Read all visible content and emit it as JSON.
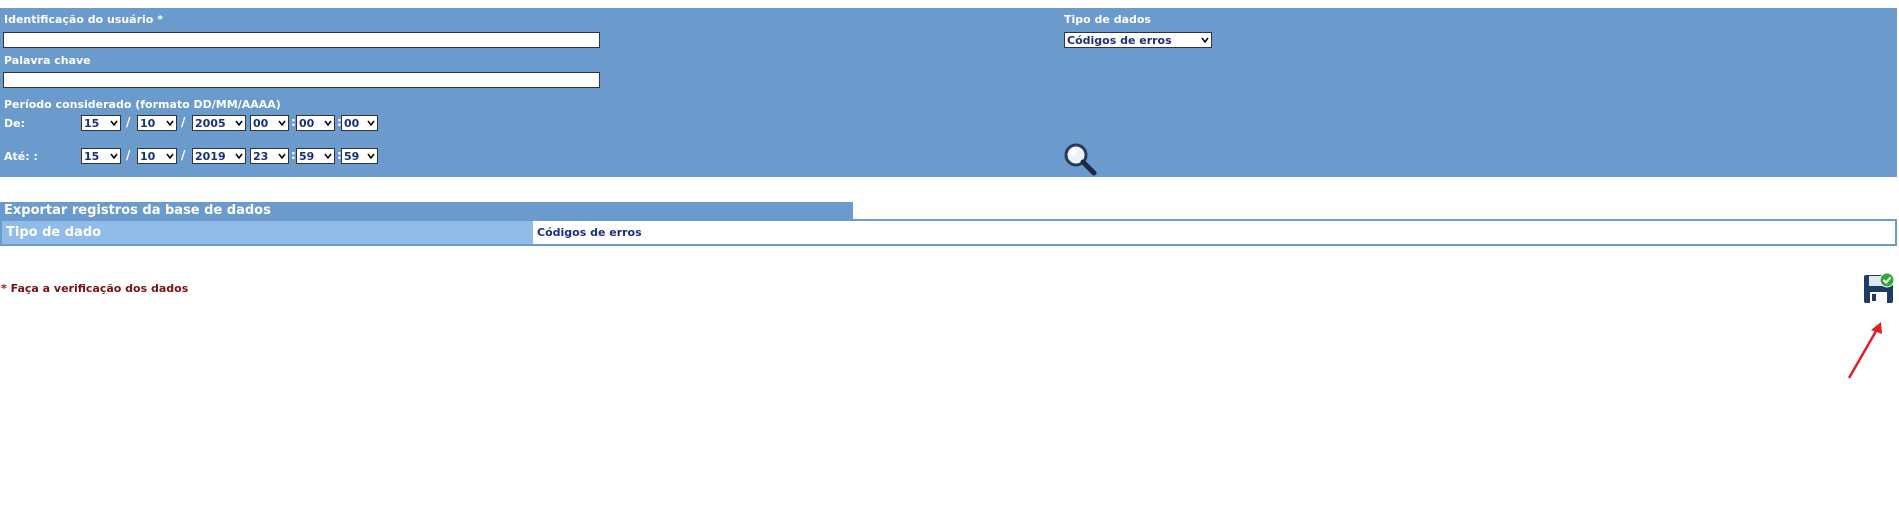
{
  "filters": {
    "user_id_label": "Identificação do usuário *",
    "user_id_value": "",
    "keyword_label": "Palavra chave",
    "keyword_value": "",
    "data_type_label": "Tipo de dados",
    "data_type_selected": "Códigos de erros",
    "period_label": "Período considerado (formato DD/MM/AAAA)",
    "from_label": "De:",
    "to_label": "Até: :",
    "from": {
      "day": "15",
      "month": "10",
      "year": "2005",
      "hour": "00",
      "minute": "00",
      "second": "00"
    },
    "to": {
      "day": "15",
      "month": "10",
      "year": "2019",
      "hour": "23",
      "minute": "59",
      "second": "59"
    },
    "date_sep": "/",
    "time_sep": ":"
  },
  "export": {
    "title": "Exportar registros da base de dados",
    "row_key": "Tipo de dado",
    "row_value": "Códigos de erros"
  },
  "note": {
    "star": "*",
    "text": "Faça a verificação dos dados"
  },
  "icons": {
    "search": "search-icon",
    "save": "save-verify-icon",
    "annotation": "red-arrow"
  },
  "colors": {
    "panel": "#6b9bcc",
    "row_key": "#91bbe9",
    "value_text": "#1c2f7c",
    "note_text": "#7a1010",
    "arrow": "#e02020"
  }
}
